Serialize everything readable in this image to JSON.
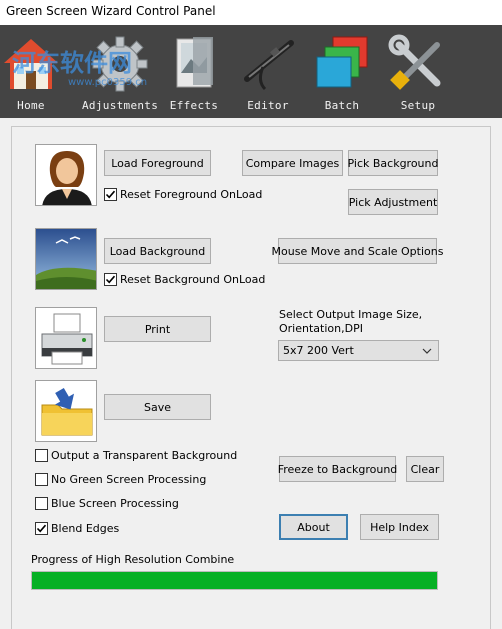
{
  "window": {
    "title": "Green Screen Wizard Control Panel"
  },
  "watermark": {
    "text": "河东软件网",
    "url": "www.pc0359.cn"
  },
  "toolbar": {
    "items": [
      {
        "label": "Home",
        "icon": "home-icon"
      },
      {
        "label": "Adjustments",
        "icon": "gear-icon"
      },
      {
        "label": "Effects",
        "icon": "effects-icon"
      },
      {
        "label": "Editor",
        "icon": "airbrush-icon"
      },
      {
        "label": "Batch",
        "icon": "layers-icon"
      },
      {
        "label": "Setup",
        "icon": "tools-icon"
      }
    ]
  },
  "foreground": {
    "load_label": "Load Foreground",
    "reset_label": "Reset Foreground OnLoad",
    "reset_checked": true
  },
  "background": {
    "load_label": "Load Background",
    "reset_label": "Reset Background OnLoad",
    "reset_checked": true
  },
  "actions": {
    "compare_label": "Compare Images",
    "pick_background_label": "Pick Background",
    "pick_adjustment_label": "Pick Adjustment",
    "mouse_options_label": "Mouse Move and Scale Options",
    "print_label": "Print",
    "save_label": "Save",
    "freeze_label": "Freeze to Background",
    "clear_label": "Clear",
    "about_label": "About",
    "help_label": "Help Index"
  },
  "output": {
    "size_label_line1": "Select Output Image Size,",
    "size_label_line2": "Orientation,DPI",
    "size_selected": "5x7 200 Vert"
  },
  "options": {
    "transparent_label": "Output a Transparent Background",
    "transparent_checked": false,
    "no_green_label": "No Green Screen Processing",
    "no_green_checked": false,
    "blue_label": "Blue Screen Processing",
    "blue_checked": false,
    "blend_label": "Blend Edges",
    "blend_checked": true
  },
  "progress": {
    "label": "Progress of High Resolution Combine",
    "value": 1.0,
    "color": "#06b025"
  }
}
